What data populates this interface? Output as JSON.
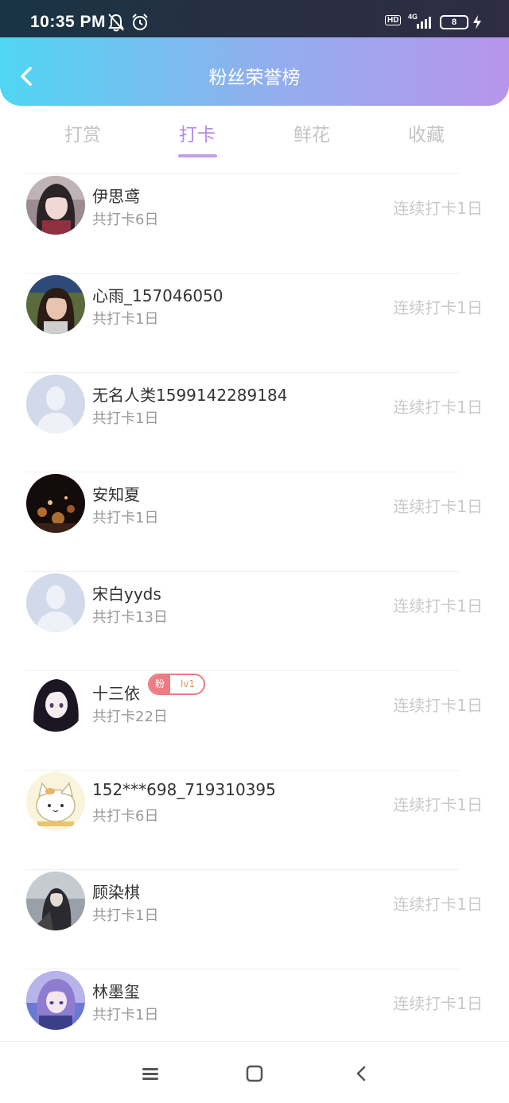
{
  "status_bar": {
    "time": "10:35 PM",
    "network": "4G",
    "hd": "HD",
    "battery": "8",
    "icons": [
      "bell-muted-icon",
      "alarm-icon",
      "hd-icon",
      "signal-icon",
      "battery-icon",
      "charging-icon"
    ]
  },
  "header": {
    "title": "粉丝荣誉榜",
    "back_icon": "chevron-left-icon"
  },
  "tabs": [
    {
      "label": "打赏",
      "active": false
    },
    {
      "label": "打卡",
      "active": true
    },
    {
      "label": "鲜花",
      "active": false
    },
    {
      "label": "收藏",
      "active": false
    }
  ],
  "fans": [
    {
      "name": "伊思鸢",
      "count": "共打卡6日",
      "streak": "连续打卡1日",
      "avatar": "photo-girl-dark-hair"
    },
    {
      "name": "心雨_157046050",
      "count": "共打卡1日",
      "streak": "连续打卡1日",
      "avatar": "photo-girl-outdoor"
    },
    {
      "name": "无名人类1599142289184",
      "count": "共打卡1日",
      "streak": "连续打卡1日",
      "avatar": "default-avatar"
    },
    {
      "name": "安知夏",
      "count": "共打卡1日",
      "streak": "连续打卡1日",
      "avatar": "photo-night-lights"
    },
    {
      "name": "宋白yyds",
      "count": "共打卡13日",
      "streak": "连续打卡1日",
      "avatar": "default-avatar"
    },
    {
      "name": "十三依",
      "count": "共打卡22日",
      "streak": "连续打卡1日",
      "avatar": "anime-girl-dark",
      "badge": {
        "label": "粉",
        "level": "lv1"
      }
    },
    {
      "name": "152***698_719310395",
      "count": "共打卡6日",
      "streak": "连续打卡1日",
      "avatar": "cartoon-cat"
    },
    {
      "name": "顾染棋",
      "count": "共打卡1日",
      "streak": "连续打卡1日",
      "avatar": "anime-figure-grey"
    },
    {
      "name": "林墨玺",
      "count": "共打卡1日",
      "streak": "连续打卡1日",
      "avatar": "anime-boy-purple"
    }
  ],
  "nav": {
    "icons": [
      "menu-icon",
      "home-square-icon",
      "back-triangle-icon"
    ]
  },
  "colors": {
    "header_gradient_start": "#4fd6f2",
    "header_gradient_end": "#b795ec",
    "active_tab": "#b38ae6",
    "badge": "#ef7b82"
  }
}
